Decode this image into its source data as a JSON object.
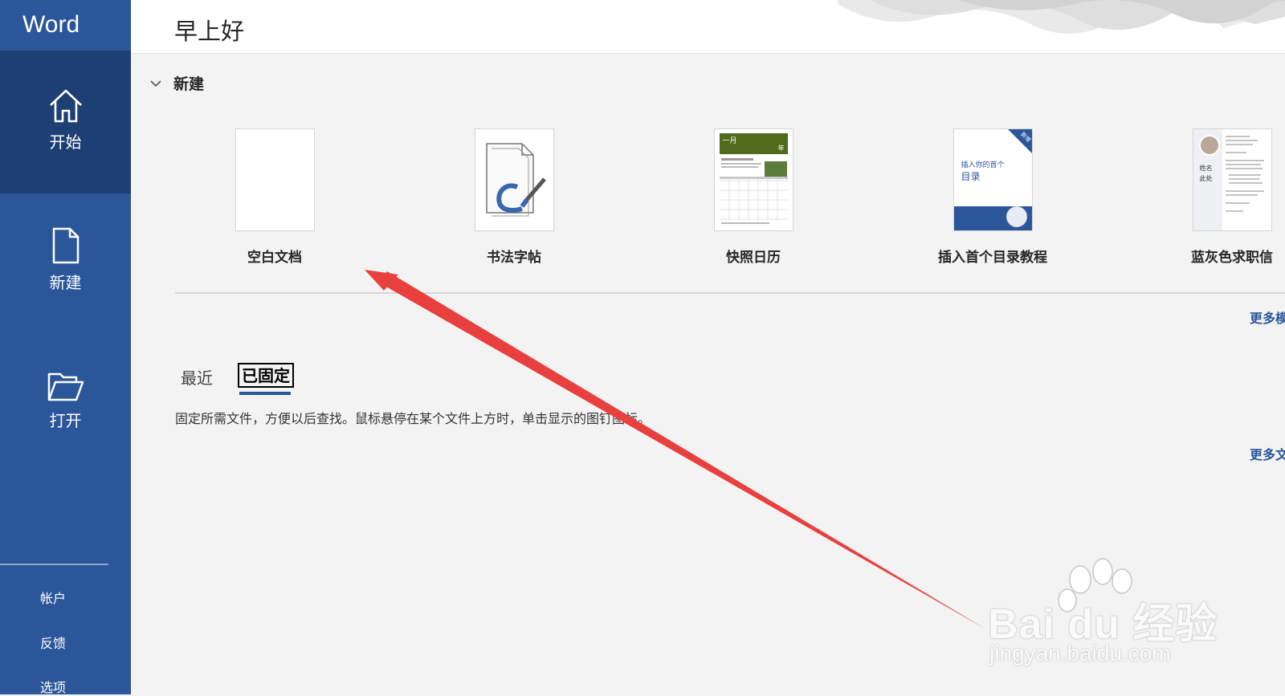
{
  "app": {
    "title": "Word"
  },
  "sidebar": {
    "items": [
      {
        "label": "开始",
        "icon": "home-icon",
        "active": true
      },
      {
        "label": "新建",
        "icon": "new-document-icon",
        "active": false
      },
      {
        "label": "打开",
        "icon": "open-folder-icon",
        "active": false
      }
    ],
    "bottom": [
      {
        "label": "帐户"
      },
      {
        "label": "反馈"
      },
      {
        "label": "选项"
      }
    ]
  },
  "header": {
    "greeting": "早上好"
  },
  "new_section": {
    "title": "新建",
    "templates": [
      {
        "label": "空白文档"
      },
      {
        "label": "书法字帖"
      },
      {
        "label": "快照日历",
        "thumb_month": "一月",
        "thumb_year": "年"
      },
      {
        "label": "插入首个目录教程",
        "thumb_text_1": "插入你的首个",
        "thumb_text_2": "目录",
        "thumb_badge": "新增"
      },
      {
        "label": "蓝灰色求职信",
        "thumb_name": "姓名",
        "thumb_here": "此处"
      }
    ],
    "more_templates": "更多模板"
  },
  "files": {
    "tabs": [
      {
        "label": "最近",
        "selected": false
      },
      {
        "label": "已固定",
        "selected": true
      }
    ],
    "pinned_message": "固定所需文件，方便以后查找。鼠标悬停在某个文件上方时，单击显示的图钉图标。",
    "more_documents": "更多文档"
  },
  "watermark": {
    "brand": "Bai du 经验",
    "url": "jingyan.baidu.com"
  },
  "colors": {
    "sidebar": "#2b579a",
    "sidebar_active": "#1e3f73",
    "accent": "#2b579a",
    "annotation_arrow": "#e8403e"
  }
}
